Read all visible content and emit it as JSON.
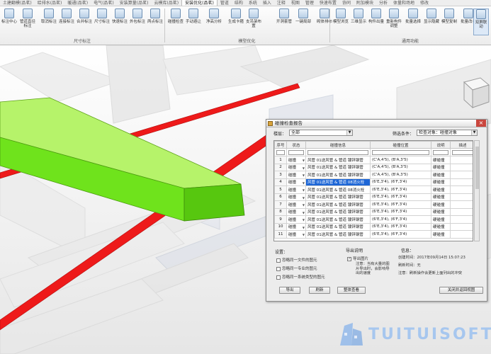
{
  "tabs": [
    "土建翻模(品茗)",
    "给排水(品茗)",
    "暖通(品茗)",
    "电气(品茗)",
    "安装算量(品茗)",
    "云模库(品茗)",
    "安装优化(品茗)",
    "管道",
    "结构",
    "系统",
    "插入",
    "注释",
    "视图",
    "管理",
    "快速布置",
    "协同",
    "附加模块",
    "分析",
    "体量和场地",
    "修改"
  ],
  "active_tab_index": 6,
  "ribbon": {
    "buttons": [
      {
        "label": "标注中心"
      },
      {
        "label": "管道直径标注"
      },
      {
        "label": "取消标注"
      },
      {
        "label": "连接标注"
      },
      {
        "label": "合并标注"
      },
      {
        "label": "尺寸标注"
      },
      {
        "label": "快速标注"
      },
      {
        "label": "外包标注"
      },
      {
        "label": "两点标注"
      },
      {
        "label": "碰撞检查"
      },
      {
        "label": "手动避让"
      },
      {
        "label": "净高分析"
      },
      {
        "label": "生成卡箍"
      },
      {
        "label": "支吊架布置"
      },
      {
        "label": "开洞套管"
      },
      {
        "label": "一键局部"
      },
      {
        "label": "砌体排布"
      },
      {
        "label": "模型浏览"
      },
      {
        "label": "三维显示"
      },
      {
        "label": "构件出量"
      },
      {
        "label": "重新构件调整"
      },
      {
        "label": "批量选择"
      },
      {
        "label": "显示隐藏"
      },
      {
        "label": "模型复制"
      },
      {
        "label": "批量改名"
      },
      {
        "label": "双屏联动"
      }
    ],
    "groups": [
      "尺寸标注",
      "模型优化",
      "通用功能"
    ]
  },
  "dialog": {
    "title": "碰撞检查报告",
    "close_icon": "×",
    "floor_label": "楼层：",
    "floor_value": "全部",
    "filter_label": "筛选条件：",
    "filter_value": "检查对象：碰撞对象",
    "columns": [
      "序号",
      "状态",
      "碰撞信息",
      "碰撞位置",
      "说明",
      "描述"
    ],
    "rows": [
      {
        "no": "1",
        "status": "碰撞",
        "info": "风管 01送风管 & 管道 镀锌钢管",
        "pos": "(C'A,4'5), (B'A,3'5)",
        "note": "硬碰撞",
        "desc": ""
      },
      {
        "no": "2",
        "status": "碰撞",
        "info": "风管 01送风管 & 管道 镀锌钢管",
        "pos": "(C'A,4'5), (B'A,3'5)",
        "note": "硬碰撞",
        "desc": ""
      },
      {
        "no": "3",
        "status": "碰撞",
        "info": "风管 01送风管 & 管道 镀锌钢管",
        "pos": "(C'A,4'5), (B'A,3'5)",
        "note": "硬碰撞",
        "desc": ""
      },
      {
        "no": "4",
        "status": "碰撞",
        "info": "风管 01送风管 & 管道 08消火栓",
        "pos": "(6'E,3'4), (6'F,3'4)",
        "note": "硬碰撞",
        "desc": ""
      },
      {
        "no": "5",
        "status": "碰撞",
        "info": "风管 01送风管 & 管道 08消火栓",
        "pos": "(6'E,3'4), (6'F,3'4)",
        "note": "硬碰撞",
        "desc": ""
      },
      {
        "no": "6",
        "status": "碰撞",
        "info": "风管 01送风管 & 管道 镀锌钢管",
        "pos": "(6'E,3'4), (6'F,3'4)",
        "note": "硬碰撞",
        "desc": ""
      },
      {
        "no": "7",
        "status": "碰撞",
        "info": "风管 01送风管 & 管道 镀锌钢管",
        "pos": "(6'E,3'4), (6'F,3'4)",
        "note": "硬碰撞",
        "desc": ""
      },
      {
        "no": "8",
        "status": "碰撞",
        "info": "风管 01送风管 & 管道 镀锌钢管",
        "pos": "(6'E,3'4), (6'F,3'4)",
        "note": "硬碰撞",
        "desc": ""
      },
      {
        "no": "9",
        "status": "碰撞",
        "info": "风管 01送风管 & 管道 镀锌钢管",
        "pos": "(6'E,3'4), (6'F,3'4)",
        "note": "硬碰撞",
        "desc": ""
      },
      {
        "no": "10",
        "status": "碰撞",
        "info": "风管 01送风管 & 管道 镀锌钢管",
        "pos": "(6'E,3'4), (6'F,3'4)",
        "note": "硬碰撞",
        "desc": ""
      },
      {
        "no": "11",
        "status": "碰撞",
        "info": "风管 01送风管 & 管道 镀锌钢管",
        "pos": "(6'E,3'4), (6'F,3'4)",
        "note": "硬碰撞",
        "desc": ""
      }
    ],
    "selected_row": 4,
    "settings_title": "设置：",
    "settings": [
      "忽略同一文件的图元",
      "忽略同一专业的图元",
      "忽略同一系统类型的图元"
    ],
    "export_title": "导出说明",
    "export_check": "导出图片",
    "export_note": "注意：当有大量的图片导出时，会影响导出的速度",
    "info_title": "信息：",
    "created_label": "创建时间：",
    "created_value": "2017年09月14日 15:07:23",
    "refresh_label": "刷新时间：",
    "refresh_value": "无",
    "info_note": "注意：刷新操作会更新上面列出的冲突",
    "buttons": {
      "export": "导出",
      "refresh": "刷新",
      "layout": "整体查看",
      "close": "关闭并返回视图"
    }
  },
  "watermark": {
    "text": "TUITUISOFT"
  },
  "colors": {
    "duct": "#6fe31c",
    "pipe": "#ee1a1a",
    "selection": "#1d66d6"
  }
}
